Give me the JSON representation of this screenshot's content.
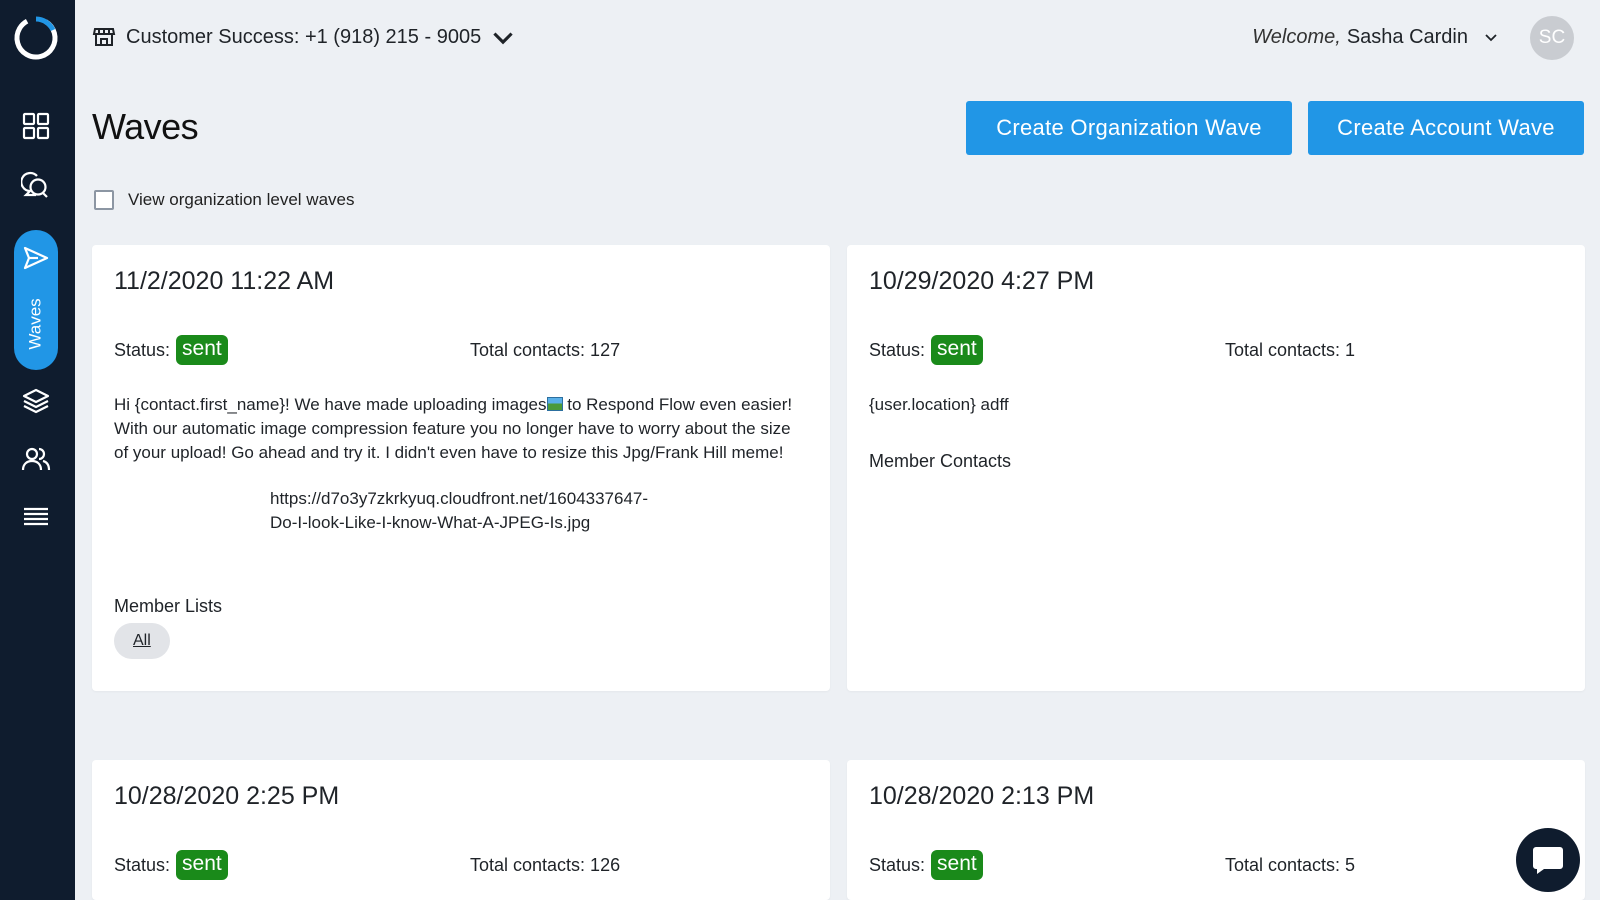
{
  "sidebar": {
    "active_label": "Waves",
    "icons": [
      "dashboard-icon",
      "conversations-icon",
      "send-icon",
      "layers-icon",
      "users-icon",
      "menu-icon"
    ]
  },
  "topbar": {
    "phone_label": "Customer Success: +1 (918) 215 - 9005",
    "welcome_prefix": "Welcome,",
    "user_name": "Sasha Cardin",
    "avatar_initials": "SC"
  },
  "header": {
    "title": "Waves",
    "create_org_label": "Create Organization Wave",
    "create_account_label": "Create Account Wave"
  },
  "filter": {
    "checkbox_label": "View organization level waves",
    "checked": false
  },
  "labels": {
    "status": "Status:",
    "member_lists": "Member Lists",
    "member_contacts": "Member Contacts"
  },
  "waves": [
    {
      "date": "11/2/2020 11:22 AM",
      "status": "sent",
      "total_contacts": "Total contacts: 127",
      "message_line1a": "Hi {contact.first_name}! We have made uploading images",
      "message_line1b": " to Respond Flow even easier!",
      "message_line2": "With our automatic image compression feature you no longer have to worry about the size",
      "message_line3": "of your upload! Go ahead and try it. I didn't even have to resize this Jpg/Frank Hill meme!",
      "link_line1": "https://d7o3y7zkrkyuq.cloudfront.net/1604337647-",
      "link_line2": "Do-I-look-Like-I-know-What-A-JPEG-Is.jpg",
      "member_list_chip": "All"
    },
    {
      "date": "10/29/2020 4:27 PM",
      "status": "sent",
      "total_contacts": "Total contacts: 1",
      "message": "{user.location} adff"
    },
    {
      "date": "10/28/2020 2:25 PM",
      "status": "sent",
      "total_contacts": "Total contacts: 126"
    },
    {
      "date": "10/28/2020 2:13 PM",
      "status": "sent",
      "total_contacts": "Total contacts: 5"
    }
  ],
  "colors": {
    "sidebar_bg": "#0f1c2e",
    "accent_blue": "#2196e6",
    "status_sent_green": "#1a8a1a",
    "page_bg": "#edf0f4"
  }
}
